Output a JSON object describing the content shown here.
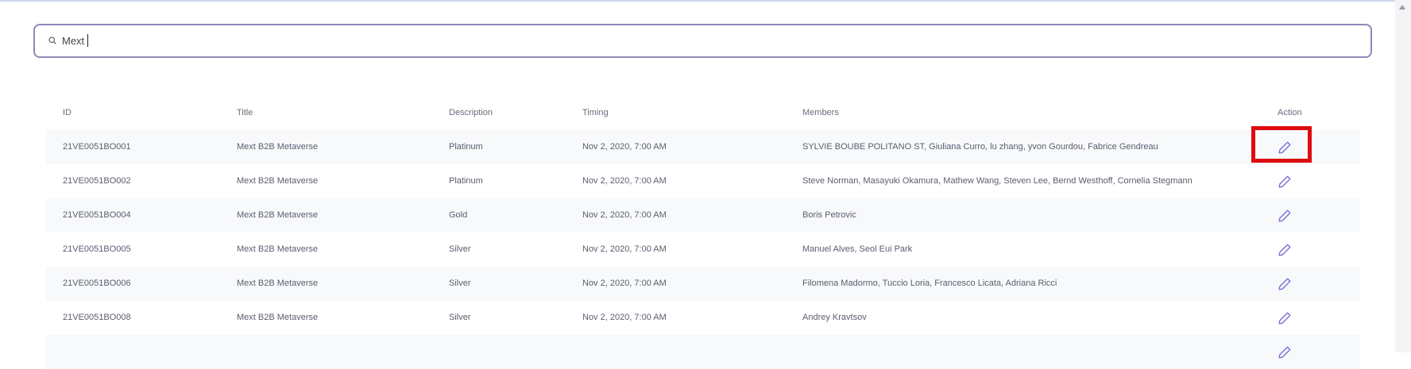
{
  "search": {
    "value": "Mext"
  },
  "table": {
    "headers": {
      "id": "ID",
      "title": "Title",
      "description": "Description",
      "timing": "Timing",
      "members": "Members",
      "action": "Action"
    },
    "rows": [
      {
        "id": "21VE0051BO001",
        "title": "Mext B2B Metaverse",
        "description": "Platinum",
        "timing": "Nov 2, 2020, 7:00 AM",
        "members": "SYLVIE BOUBE POLITANO ST, Giuliana Curro, lu zhang, yvon Gourdou, Fabrice Gendreau"
      },
      {
        "id": "21VE0051BO002",
        "title": "Mext B2B Metaverse",
        "description": "Platinum",
        "timing": "Nov 2, 2020, 7:00 AM",
        "members": "Steve Norman, Masayuki Okamura, Mathew Wang, Steven Lee, Bernd Westhoff, Cornelia Stegmann"
      },
      {
        "id": "21VE0051BO004",
        "title": "Mext B2B Metaverse",
        "description": "Gold",
        "timing": "Nov 2, 2020, 7:00 AM",
        "members": "Boris Petrovic"
      },
      {
        "id": "21VE0051BO005",
        "title": "Mext B2B Metaverse",
        "description": "Silver",
        "timing": "Nov 2, 2020, 7:00 AM",
        "members": "Manuel Alves, Seol Eui Park"
      },
      {
        "id": "21VE0051BO006",
        "title": "Mext B2B Metaverse",
        "description": "Silver",
        "timing": "Nov 2, 2020, 7:00 AM",
        "members": "Filomena Madormo, Tuccio Loria, Francesco Licata, Adriana Ricci"
      },
      {
        "id": "21VE0051BO008",
        "title": "Mext B2B Metaverse",
        "description": "Silver",
        "timing": "Nov 2, 2020, 7:00 AM",
        "members": "Andrey Kravtsov"
      },
      {
        "id": "",
        "title": "",
        "description": "",
        "timing": "",
        "members": ""
      }
    ]
  },
  "colors": {
    "accent": "#7b6fd6",
    "highlight": "#dd0b10",
    "search_border": "#8f89b8",
    "row_alt": "#f8f9fb"
  },
  "icons": {
    "search": "search-icon",
    "edit": "pencil-edit-icon"
  }
}
